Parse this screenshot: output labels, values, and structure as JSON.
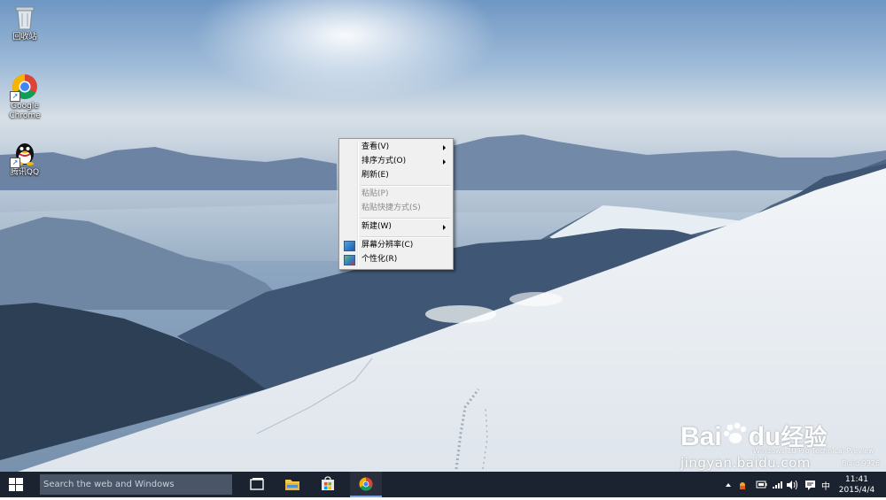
{
  "desktop": {
    "icons": [
      {
        "label": "回收站",
        "icon": "recycle-bin-icon"
      },
      {
        "label": "Google Chrome",
        "icon": "chrome-icon"
      },
      {
        "label": "腾讯QQ",
        "icon": "qq-icon"
      }
    ]
  },
  "context_menu": {
    "items": [
      {
        "label": "查看(V)",
        "submenu": true,
        "enabled": true
      },
      {
        "label": "排序方式(O)",
        "submenu": true,
        "enabled": true
      },
      {
        "label": "刷新(E)",
        "submenu": false,
        "enabled": true
      },
      {
        "label": "粘贴(P)",
        "submenu": false,
        "enabled": false
      },
      {
        "label": "粘贴快捷方式(S)",
        "submenu": false,
        "enabled": false
      },
      {
        "label": "新建(W)",
        "submenu": true,
        "enabled": true
      },
      {
        "label": "屏幕分辨率(C)",
        "submenu": false,
        "enabled": true,
        "icon": "screen-resolution-icon"
      },
      {
        "label": "个性化(R)",
        "submenu": false,
        "enabled": true,
        "icon": "personalize-icon"
      }
    ]
  },
  "watermark": {
    "os_line": "Windows 10 Pro Technical Preview",
    "build": "Build 9926",
    "brand": "Bai",
    "brand2": "du",
    "brand_cn": "经验",
    "site": "jingyan.baidu.com"
  },
  "taskbar": {
    "search_placeholder": "Search the web and Windows",
    "apps": [
      "task-view-icon",
      "file-explorer-icon",
      "store-icon",
      "chrome-icon"
    ],
    "tray": {
      "ime": "中"
    },
    "clock": {
      "time": "11:41",
      "date": "2015/4/4"
    }
  },
  "colors": {
    "taskbar": "#1c2330",
    "search_box": "#4a5667",
    "menu_bg": "#f0f0f0",
    "accent": "#7aa7e0"
  }
}
